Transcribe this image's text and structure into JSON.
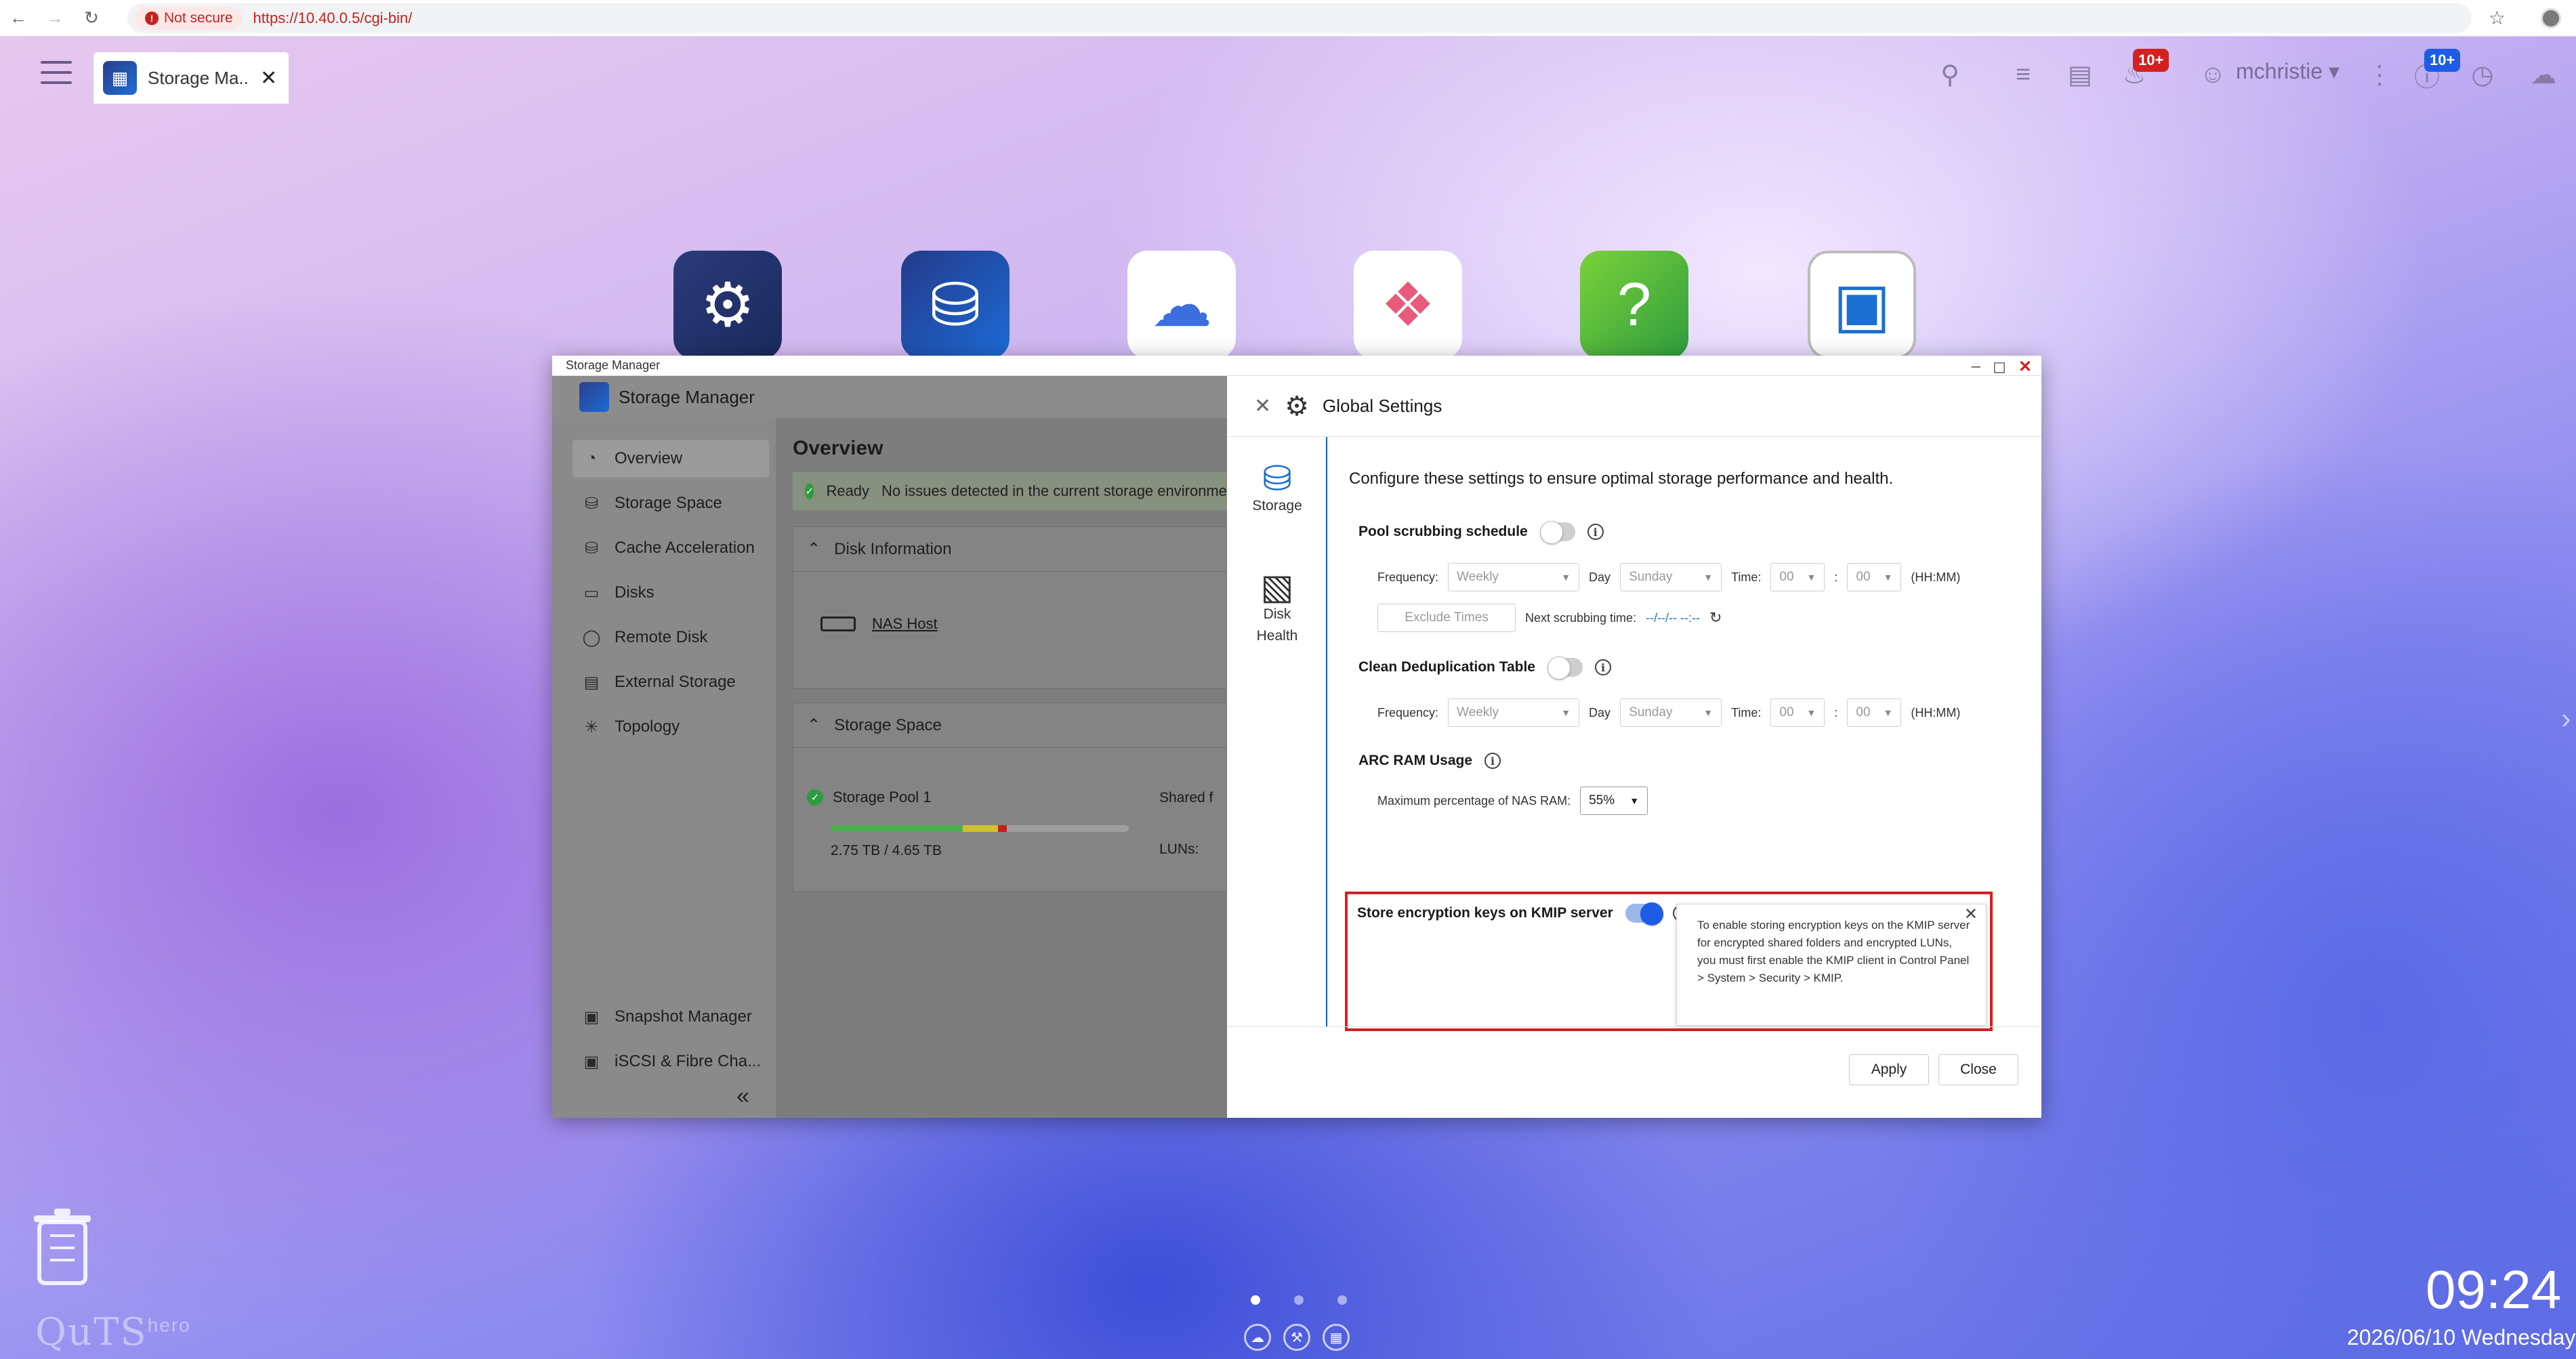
{
  "browser": {
    "not_secure_label": "Not secure",
    "url": "https://10.40.0.5/cgi-bin/"
  },
  "taskbar": {
    "app_tab_label": "Storage Ma...",
    "username": "mchristie",
    "notification_badge": "10+",
    "info_badge": "10+"
  },
  "window": {
    "titlebar": "Storage Manager",
    "app_name": "Storage Manager"
  },
  "sidebar": {
    "items": [
      {
        "label": "Overview",
        "icon": "overview-icon"
      },
      {
        "label": "Storage Space",
        "icon": "storage-space-icon"
      },
      {
        "label": "Cache Acceleration",
        "icon": "cache-icon"
      },
      {
        "label": "Disks",
        "icon": "disk-icon"
      },
      {
        "label": "Remote Disk",
        "icon": "remote-disk-icon"
      },
      {
        "label": "External Storage",
        "icon": "external-storage-icon"
      },
      {
        "label": "Topology",
        "icon": "topology-icon"
      }
    ],
    "bottom_items": [
      {
        "label": "Snapshot Manager"
      },
      {
        "label": "iSCSI & Fibre Cha..."
      }
    ]
  },
  "overview": {
    "title": "Overview",
    "status": "Ready",
    "status_message": "No issues detected in the current storage environme",
    "disk_info_header": "Disk Information",
    "nas_host": "NAS Host",
    "storage_space_header": "Storage Space",
    "pool_name": "Storage Pool 1",
    "pool_usage": "2.75 TB / 4.65 TB",
    "pool_used_fraction": 0.59,
    "shared_label": "Shared f",
    "luns_label": "LUNs:"
  },
  "global_settings": {
    "title": "Global Settings",
    "nav": [
      {
        "label": "Storage",
        "icon": "database-icon"
      },
      {
        "label": "Disk Health",
        "icon": "hdd-icon"
      }
    ],
    "description": "Configure these settings to ensure optimal storage performance and health.",
    "pool_scrubbing": {
      "label": "Pool scrubbing schedule",
      "enabled": false,
      "frequency_label": "Frequency:",
      "frequency": "Weekly",
      "day_label": "Day",
      "day": "Sunday",
      "time_label": "Time:",
      "hour": "00",
      "minute": "00",
      "colon": ":",
      "format": "(HH:MM)",
      "exclude_button": "Exclude Times",
      "next_label": "Next scrubbing time:",
      "next_value": "--/--/-- --:--"
    },
    "dedup": {
      "label": "Clean Deduplication Table",
      "enabled": false,
      "frequency_label": "Frequency:",
      "frequency": "Weekly",
      "day_label": "Day",
      "day": "Sunday",
      "time_label": "Time:",
      "hour": "00",
      "minute": "00",
      "colon": ":",
      "format": "(HH:MM)"
    },
    "arc_ram": {
      "label": "ARC RAM Usage",
      "max_label": "Maximum percentage of NAS RAM:",
      "value": "55%"
    },
    "kmip": {
      "label": "Store encryption keys on KMIP server",
      "enabled": true,
      "tooltip": "To enable storing encryption keys on the KMIP server for encrypted shared folders and encrypted LUNs, you must first enable the KMIP client in Control Panel > System > Security > KMIP."
    },
    "apply_button": "Apply",
    "close_button": "Close"
  },
  "desktop": {
    "time": "09:24",
    "date": "2026/06/10 Wednesday",
    "logo": "QuTS",
    "logo_suffix": "hero"
  },
  "colors": {
    "accent": "#1e5ce6",
    "highlight_box": "#d42020",
    "ready_green": "#2e9c3e"
  }
}
